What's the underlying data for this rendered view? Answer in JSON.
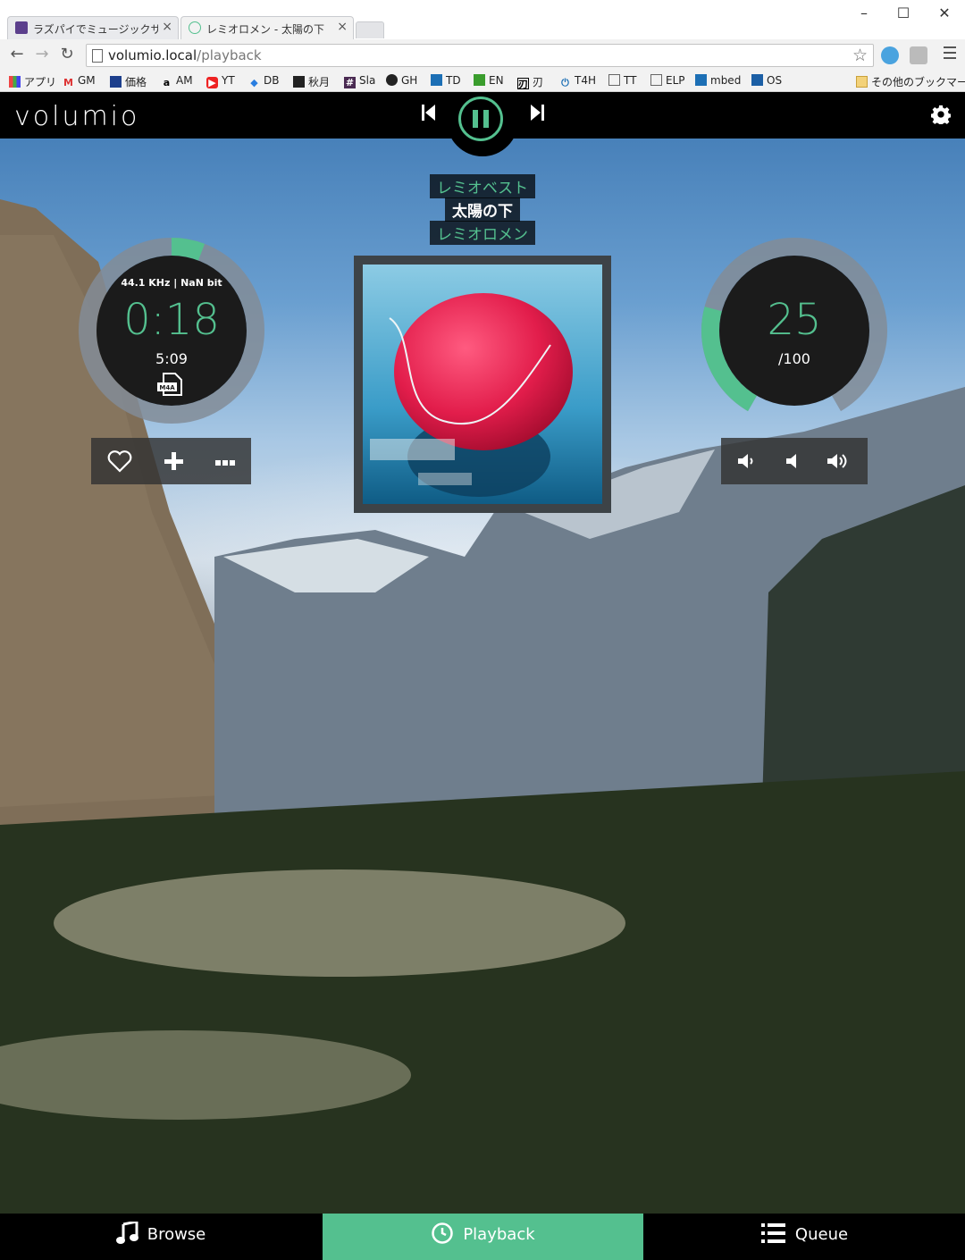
{
  "browser": {
    "tabs": [
      {
        "label": "ラズパイでミュージックサーバー・",
        "active": false
      },
      {
        "label": "レミオロメン - 太陽の下",
        "active": true
      }
    ],
    "url_host": "volumio.local",
    "url_path": "/playback",
    "bookmarks": [
      {
        "label": "アプリ",
        "icon": "apps-grid-icon"
      },
      {
        "label": "GM",
        "icon": "gmail-icon"
      },
      {
        "label": "価格",
        "icon": "kakaku-icon"
      },
      {
        "label": "AM",
        "icon": "amazon-icon"
      },
      {
        "label": "YT",
        "icon": "youtube-icon"
      },
      {
        "label": "DB",
        "icon": "dropbox-icon"
      },
      {
        "label": "秋月",
        "icon": "chip-icon"
      },
      {
        "label": "Sla",
        "icon": "slack-icon"
      },
      {
        "label": "GH",
        "icon": "github-icon"
      },
      {
        "label": "TD",
        "icon": "tweetdeck-icon"
      },
      {
        "label": "EN",
        "icon": "evernote-icon"
      },
      {
        "label": "刃",
        "icon": "kanji-icon"
      },
      {
        "label": "T4H",
        "icon": "power-icon"
      },
      {
        "label": "TT",
        "icon": "page-icon"
      },
      {
        "label": "ELP",
        "icon": "page-icon"
      },
      {
        "label": "mbed",
        "icon": "arm-icon"
      },
      {
        "label": "OS",
        "icon": "onshape-icon"
      }
    ],
    "other_bookmarks": "その他のブックマーク"
  },
  "app": {
    "logo": "volumio",
    "album": "レミオベスト",
    "track": "太陽の下",
    "artist": "レミオロメン",
    "quality": "44.1 KHz | NaN bit",
    "elapsed": "0:18",
    "duration": "5:09",
    "format": "M4A",
    "progress_fraction": 0.058,
    "volume": "25",
    "volume_max": "/100",
    "volume_fraction": 0.25,
    "accent": "#54c08f"
  },
  "nav": {
    "browse": "Browse",
    "playback": "Playback",
    "queue": "Queue"
  }
}
